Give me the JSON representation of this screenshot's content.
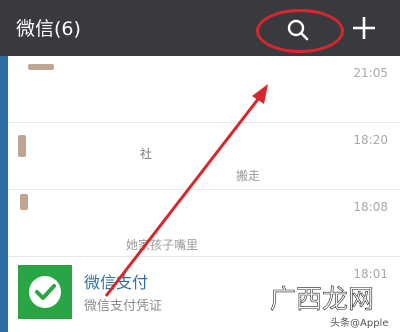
{
  "app": {
    "title": "微信(6)",
    "search_icon": "search-icon",
    "add_icon": "plus-icon"
  },
  "chats": [
    {
      "time": "21:05",
      "preview": ""
    },
    {
      "time": "18:20",
      "name_fragment": "社",
      "preview_fragment": "搬走"
    },
    {
      "time": "18:08",
      "preview_fragment": "她家孩子嘴里"
    },
    {
      "time": "18:01",
      "name": "微信支付",
      "preview": "微信支付凭证"
    }
  ],
  "watermark": {
    "logo_text": "广西龙网",
    "source": "头条@Apple"
  },
  "colors": {
    "topbar": "#393a3f",
    "highlight": "#d7272a",
    "pay_green": "#29a545",
    "pay_name": "#2f6fa8"
  }
}
